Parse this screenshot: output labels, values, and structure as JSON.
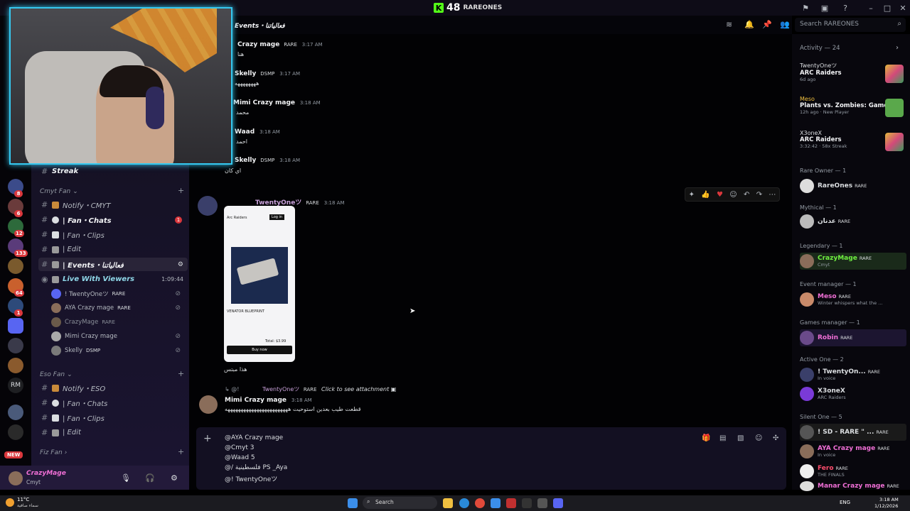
{
  "window": {
    "app_title": "RAREONES",
    "viewer_count": "48"
  },
  "header": {
    "channel_name": "Events・فعالياتنا",
    "search_placeholder": "Search RAREONES"
  },
  "server_rail": {
    "badges": [
      "8",
      "6",
      "12",
      "133",
      "64",
      "1"
    ],
    "rm_label": "RM",
    "new_label": "NEW"
  },
  "sidebar": {
    "top_channel": "Streak",
    "categories": [
      {
        "name": "Cmyt Fan",
        "channels": [
          {
            "label": "Notify・CMYT",
            "style": "normal"
          },
          {
            "label": "| Fan・Chats",
            "style": "bold",
            "mention": "1"
          },
          {
            "label": "| Fan・Clips",
            "style": "normal"
          },
          {
            "label": "| Edit",
            "style": "normal"
          },
          {
            "label": "| Events・فعالياتنا",
            "style": "bold active"
          },
          {
            "label": "Live With Viewers",
            "style": "voice",
            "timer": "1:09:44"
          }
        ]
      },
      {
        "name": "Eso Fan",
        "channels": [
          {
            "label": "Notify・ESO"
          },
          {
            "label": "| Fan・Chats"
          },
          {
            "label": "| Fan・Clips"
          },
          {
            "label": "| Edit"
          }
        ]
      },
      {
        "name": "Fiz Fan",
        "channels": []
      }
    ],
    "voice_users": [
      {
        "name": "! TwentyOneツ",
        "tag": "RARE"
      },
      {
        "name": "AYA Crazy mage",
        "tag": "RARE"
      },
      {
        "name": "CrazyMage",
        "tag": "RARE"
      },
      {
        "name": "Mimi Crazy mage",
        "tag": ""
      },
      {
        "name": "Skelly",
        "tag": "DSMP"
      }
    ]
  },
  "user_panel": {
    "name": "CrazyMage",
    "status": "Cmyt"
  },
  "messages": [
    {
      "author": "Crazy mage",
      "role": "RARE",
      "time": "3:17 AM",
      "body": "هنا"
    },
    {
      "author": "Skelly",
      "role": "DSMP",
      "time": "3:17 AM",
      "body": "ههههههههه"
    },
    {
      "author": "Mimi Crazy mage",
      "role": "",
      "time": "3:18 AM",
      "body": "محمد"
    },
    {
      "author": "Waad",
      "role": "",
      "time": "3:18 AM",
      "body": "احمد"
    },
    {
      "author": "Skelly",
      "role": "DSMP",
      "time": "3:18 AM",
      "body": "اي كان"
    },
    {
      "author": "TwentyOneツ",
      "role": "RARE",
      "time": "3:18 AM",
      "body": "هذا مبتس"
    },
    {
      "author": "Mimi Crazy mage",
      "role": "",
      "time": "3:18 AM",
      "body": "قطعت طيب بعدين استوحيت ههههههههههههههههههههههههه"
    }
  ],
  "reply_preview": {
    "name": "TwentyOneツ",
    "role": "RARE",
    "text": "Click to see attachment"
  },
  "attachment": {
    "item_name": "VENATOR BLUEPRINT",
    "total": "Total: $3.99",
    "buy": "Buy now",
    "login": "Log in",
    "header": "Arc Raiders"
  },
  "composer": {
    "lines": [
      "@AYA Crazy mage",
      "@Cmyt 3",
      "@Waad 5",
      "@/ فلسطينية PS _Aya",
      "@!          TwentyOneツ"
    ]
  },
  "activity": {
    "header": "Activity — 24",
    "items": [
      {
        "user": "TwentyOneツ",
        "game": "ARC Raiders",
        "meta": "6d ago",
        "color": "#e2b93b"
      },
      {
        "user": "Meso",
        "game": "Plants vs. Zombies: Game ...",
        "meta": "12h ago · New Player",
        "color": "#5aa84b"
      },
      {
        "user": "X3oneX",
        "game": "ARC Raiders",
        "meta": "3:32:42 · 58x Streak",
        "color": "#e2b93b"
      }
    ]
  },
  "roles": [
    {
      "header": "Rare Owner — 1",
      "members": [
        {
          "name": "RareOnes",
          "tag": "RARE",
          "sub": "",
          "color": "#dbdee1"
        }
      ]
    },
    {
      "header": "Mythical — 1",
      "members": [
        {
          "name": "عدنان",
          "tag": "RARE",
          "sub": "",
          "color": "#dbdee1"
        }
      ]
    },
    {
      "header": "Legendary — 1",
      "members": [
        {
          "name": "CrazyMage",
          "tag": "RARE",
          "sub": "Cmyt",
          "color": "#6ff040"
        }
      ]
    },
    {
      "header": "Event manager — 1",
      "members": [
        {
          "name": "Meso",
          "tag": "RARE",
          "sub": "Winter whispers what the ...",
          "color": "#f06fd6"
        }
      ]
    },
    {
      "header": "Games manager — 1",
      "members": [
        {
          "name": "Robin",
          "tag": "RARE",
          "sub": "",
          "color": "#f06fd6"
        }
      ]
    },
    {
      "header": "Active One — 2",
      "members": [
        {
          "name": "! TwentyOn...",
          "tag": "RARE",
          "sub": "In voice",
          "color": "#dbdee1"
        },
        {
          "name": "X3oneX",
          "tag": "",
          "sub": "ARC Raiders",
          "color": "#dbdee1"
        }
      ]
    },
    {
      "header": "Silent One — 5",
      "members": [
        {
          "name": "! SD - RARE \" ...",
          "tag": "RARE",
          "sub": "",
          "color": "#dbdee1"
        },
        {
          "name": "AYA Crazy mage",
          "tag": "RARE",
          "sub": "In voice",
          "color": "#f06fd6"
        },
        {
          "name": "Fero",
          "tag": "RARE",
          "sub": "THE FINALS",
          "color": "#ff4d6d"
        },
        {
          "name": "Manar Crazy mage",
          "tag": "RARE",
          "sub": "",
          "color": "#f06fd6"
        }
      ]
    }
  ],
  "taskbar": {
    "temp": "11°C",
    "weather": "سماء صافية",
    "search": "Search",
    "lang": "ENG",
    "time": "3:18 AM",
    "date": "1/12/2026"
  }
}
